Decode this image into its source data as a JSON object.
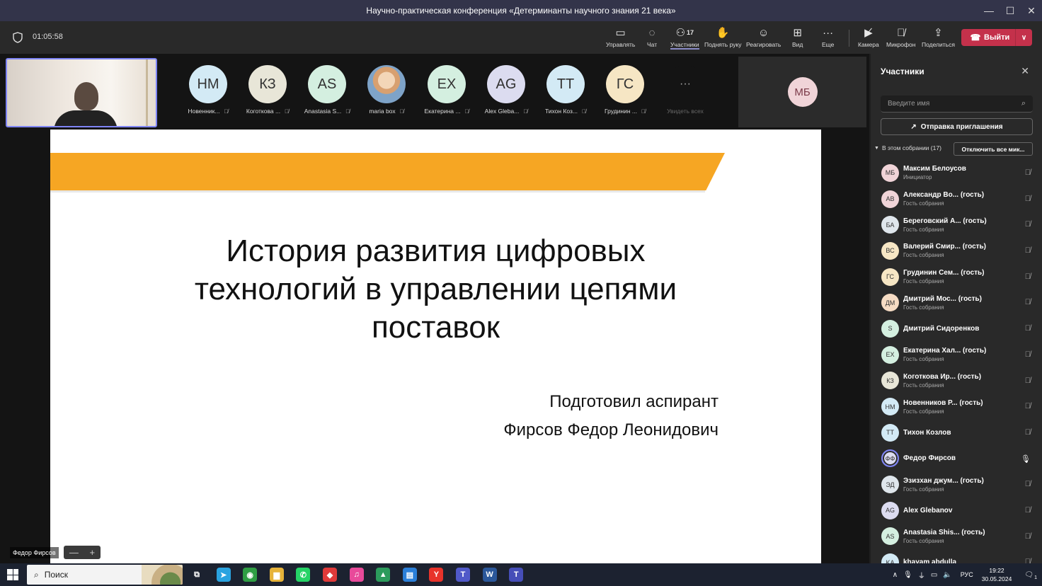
{
  "window": {
    "title": "Научно-практическая конференция «Детерминанты научного знания 21 века»",
    "minimize": "—",
    "maximize": "☐",
    "close": "✕"
  },
  "toolbar": {
    "timer": "01:05:58",
    "participants_count": "17",
    "buttons": [
      {
        "label": "Управлять",
        "icon": "share-tray-icon"
      },
      {
        "label": "Чат",
        "icon": "chat-icon"
      },
      {
        "label": "Участники",
        "icon": "people-icon"
      },
      {
        "label": "Поднять руку",
        "icon": "raise-hand-icon"
      },
      {
        "label": "Реагировать",
        "icon": "smile-icon"
      },
      {
        "label": "Вид",
        "icon": "grid-icon"
      },
      {
        "label": "Еще",
        "icon": "more-icon"
      },
      {
        "label": "Камера",
        "icon": "camera-off-icon"
      },
      {
        "label": "Микрофон",
        "icon": "mic-off-icon"
      },
      {
        "label": "Поделиться",
        "icon": "share-icon"
      }
    ],
    "leave_label": "Выйти"
  },
  "gallery": [
    {
      "initials": "НМ",
      "name": "Новенник...",
      "color": "#d3eaf5"
    },
    {
      "initials": "КЗ",
      "name": "Коготкова ...",
      "color": "#e8e6d8"
    },
    {
      "initials": "AS",
      "name": "Anastasia S...",
      "color": "#d4efe0"
    },
    {
      "initials": "",
      "name": "maria box",
      "color": "#f3d6b8"
    },
    {
      "initials": "ЕХ",
      "name": "Екатерина ...",
      "color": "#d4efe0"
    },
    {
      "initials": "AG",
      "name": "Alex Gleba...",
      "color": "#dcdcf0"
    },
    {
      "initials": "ТТ",
      "name": "Тихон Коз...",
      "color": "#d3eaf5"
    },
    {
      "initials": "ГС",
      "name": "Грудинин ...",
      "color": "#f6e6c4"
    }
  ],
  "see_all": {
    "glyph": "···",
    "label": "Увидеть всех"
  },
  "spotlight_initials": "МБ",
  "slide": {
    "title_lines": [
      "История развития цифровых",
      "технологий в управлении цепями",
      "поставок"
    ],
    "author_lines": [
      "Подготовил аспирант",
      "Фирсов Федор Леонидович"
    ]
  },
  "presenter_tag": "Федор Фирсов",
  "zoom": {
    "minus": "—",
    "plus": "+"
  },
  "panel": {
    "title": "Участники",
    "close": "✕",
    "search_placeholder": "Введите имя",
    "invite_label": "Отправка приглашения",
    "section_label": "В этом собрании (17)",
    "mute_all_label": "Отключить все мик...",
    "participants": [
      {
        "initials": "МБ",
        "name": "Максим Белоусов",
        "role": "Инициатор",
        "color": "#f0d4d8",
        "mic": "off"
      },
      {
        "initials": "АВ",
        "name": "Александр Во...  (гость)",
        "role": "Гость собрания",
        "color": "#f0d4d8",
        "mic": "off"
      },
      {
        "initials": "БА",
        "name": "Береговский А... (гость)",
        "role": "Гость собрания",
        "color": "#dfe6ec",
        "mic": "off"
      },
      {
        "initials": "ВС",
        "name": "Валерий Смир... (гость)",
        "role": "Гость собрания",
        "color": "#f6e6c4",
        "mic": "off"
      },
      {
        "initials": "ГС",
        "name": "Грудинин Сем... (гость)",
        "role": "Гость собрания",
        "color": "#f6e6c4",
        "mic": "off"
      },
      {
        "initials": "ДМ",
        "name": "Дмитрий Мос... (гость)",
        "role": "Гость собрания",
        "color": "#f6dcc4",
        "mic": "off"
      },
      {
        "initials": "S",
        "name": "Дмитрий Сидоренков",
        "role": "",
        "color": "#d4efe0",
        "mic": "off"
      },
      {
        "initials": "ЕХ",
        "name": "Екатерина Хал... (гость)",
        "role": "Гость собрания",
        "color": "#d4efe0",
        "mic": "off"
      },
      {
        "initials": "КЗ",
        "name": "Коготкова Ир... (гость)",
        "role": "Гость собрания",
        "color": "#e8e6d8",
        "mic": "off"
      },
      {
        "initials": "НМ",
        "name": "Новенников Р... (гость)",
        "role": "Гость собрания",
        "color": "#d3eaf5",
        "mic": "off"
      },
      {
        "initials": "ТТ",
        "name": "Тихон Козлов",
        "role": "",
        "color": "#d3eaf5",
        "mic": "off"
      },
      {
        "initials": "ФФ",
        "name": "Федор Фирсов",
        "role": "",
        "color": "#dcdcf0",
        "mic": "on"
      },
      {
        "initials": "ЭД",
        "name": "Эзизхан джум... (гость)",
        "role": "Гость собрания",
        "color": "#dfe6ec",
        "mic": "off"
      },
      {
        "initials": "AG",
        "name": "Alex Glebanov",
        "role": "",
        "color": "#dcdcf0",
        "mic": "off"
      },
      {
        "initials": "AS",
        "name": "Anastasia Shis... (гость)",
        "role": "Гость собрания",
        "color": "#d4efe0",
        "mic": "off"
      },
      {
        "initials": "KA",
        "name": "khayam abdulla",
        "role": "",
        "color": "#d3eaf5",
        "mic": "off"
      }
    ]
  },
  "taskbar": {
    "search_label": "Поиск",
    "lang": "РУС",
    "time": "19:22",
    "date": "30.05.2024",
    "notif_count": "1",
    "apps": [
      {
        "name": "task-view-icon",
        "glyph": "⧉",
        "color": "#1c2230"
      },
      {
        "name": "telegram-icon",
        "glyph": "➤",
        "color": "#2aa3e0"
      },
      {
        "name": "chrome-icon",
        "glyph": "◉",
        "color": "#2f9e44"
      },
      {
        "name": "explorer-icon",
        "glyph": "▆",
        "color": "#e6b33a"
      },
      {
        "name": "whatsapp-icon",
        "glyph": "✆",
        "color": "#25d366"
      },
      {
        "name": "anydesk-icon",
        "glyph": "◆",
        "color": "#e03a3a"
      },
      {
        "name": "itunes-icon",
        "glyph": "♫",
        "color": "#e84a9a"
      },
      {
        "name": "google-drive-icon",
        "glyph": "▲",
        "color": "#2c9b5c"
      },
      {
        "name": "store-icon",
        "glyph": "▤",
        "color": "#2b7fd8"
      },
      {
        "name": "yandex-icon",
        "glyph": "Y",
        "color": "#e8332b"
      },
      {
        "name": "teams-icon",
        "glyph": "T",
        "color": "#5059c9"
      },
      {
        "name": "word-icon",
        "glyph": "W",
        "color": "#2b579a"
      },
      {
        "name": "teams-classic-icon",
        "glyph": "T",
        "color": "#464eb8"
      }
    ]
  },
  "colors": {
    "accent": "#7f85f5",
    "leave": "#c4314b",
    "slide_band": "#f6a623"
  }
}
